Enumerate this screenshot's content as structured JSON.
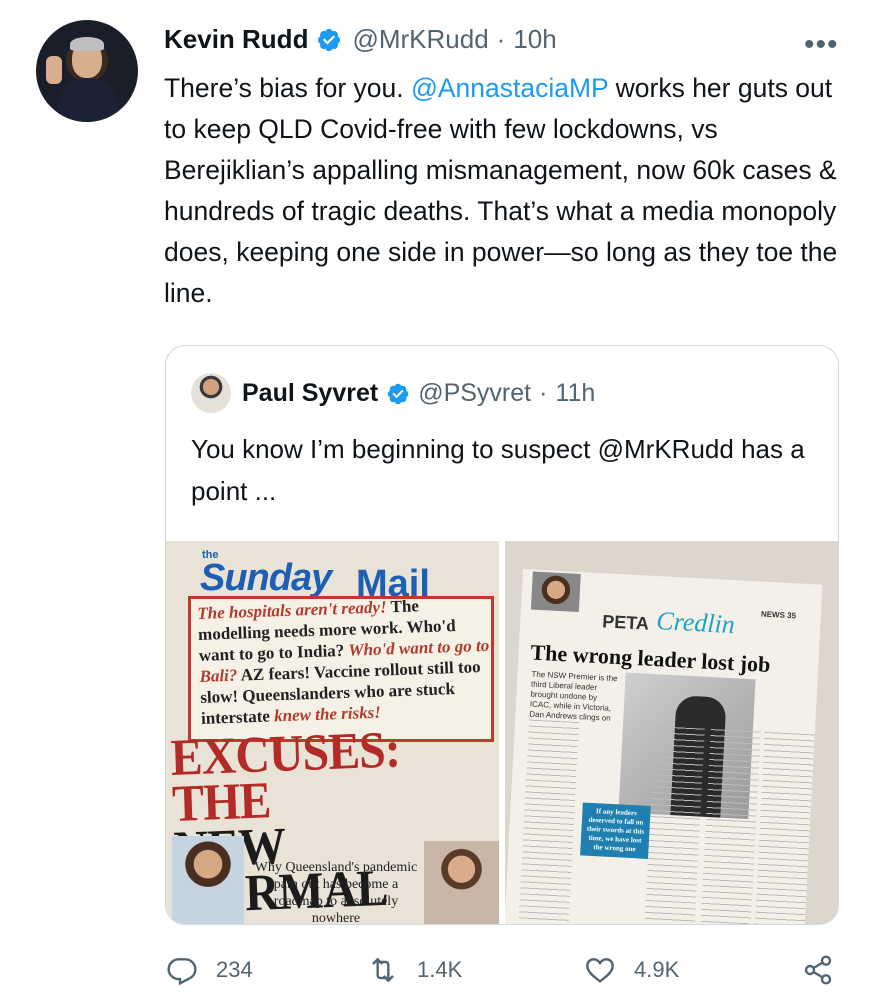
{
  "tweet": {
    "author_name": "Kevin Rudd",
    "author_handle": "@MrKRudd",
    "separator": "·",
    "time": "10h",
    "more_label": "•••",
    "text_parts": [
      "There’s bias for you. ",
      "@AnnastaciaMP",
      " works her guts out to keep QLD Covid-free with few lockdowns, vs Berejiklian’s appalling mismanagement, now 60k cases & hundreds of tragic deaths. That’s what a media monopoly does, keeping one side in power—so long as they toe the line."
    ]
  },
  "quote": {
    "author_name": "Paul Syvret",
    "author_handle": "@PSyvret",
    "separator": "·",
    "time": "11h",
    "text": "You know I’m beginning to suspect @MrKRudd has a point ...",
    "image_left": {
      "masthead_the": "the",
      "masthead_sunday": "Sunday",
      "masthead_mail": "Mail",
      "blurb_parts": [
        "The hospitals aren't ready!",
        " The modelling needs more work. Who'd want to go to India? ",
        "Who'd want to go to Bali?",
        " AZ fears! Vaccine rollout still too slow! Queenslanders who are stuck interstate ",
        "knew the risks!"
      ],
      "headline_1": "EXCUSES: THE",
      "headline_2": "NEW NORMAL",
      "caption": "Why Queensland's pandemic path out has become a roadmap to absolutely nowhere"
    },
    "image_right": {
      "peta": "PETA",
      "credlin": "Credlin",
      "section": "NEWS 35",
      "headline": "The wrong leader lost job",
      "dek": "The NSW Premier is the third Liberal leader brought undone by ICAC, while in Victoria, Dan Andrews clings on",
      "pullquote": "If any leaders deserved to fall on their swords at this time, we have lost the wrong one"
    }
  },
  "actions": {
    "replies": "234",
    "retweets": "1.4K",
    "likes": "4.9K"
  },
  "colors": {
    "link": "#1d9bf0",
    "secondary": "#536471",
    "verified": "#1d9bf0"
  }
}
